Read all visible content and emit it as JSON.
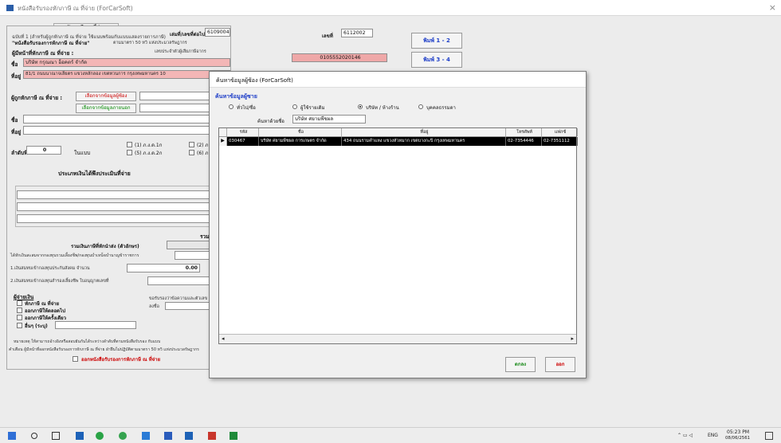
{
  "window": {
    "title": "หนังสือรับรองหักภาษี ณ ที่จ่าย (ForCarSoft)",
    "close": "×"
  },
  "form": {
    "tab_label": "หักภาษี ณ ที่จ่าย",
    "section_text1": "ฉบับที่ 1 (สำหรับผู้ถูกหักภาษี ณ ที่จ่าย ใช้แนบพร้อมกับแบบแสดงรายการภาษี)",
    "section_text2": "\"หนังสือรับรองการหักภาษี ณ ที่จ่าย\"",
    "law_text": "ตามมาตรา 50 ทวิ แห่งประมวลรัษฎากร",
    "book_no_label": "เล่มที่/เลขที่ต่อไป",
    "book_no_value": "6109004",
    "number_label": "เลขที่",
    "number_value": "6112002",
    "payer_label": "ผู้มีหน้าที่หักภาษี ณ ที่จ่าย :",
    "taxid_label": "เลขประจำตัวผู้เสียภาษีอากร",
    "taxid_value": "0105552020146",
    "name_label": "ชื่อ",
    "payer_name": "บริษัท กรุณณา อ็อคตร์ จำกัด",
    "address_label": "ที่อยู่",
    "payer_address": "81/1 ถนนนาณาจเลียตร แขวงหลักลอง เขตทวนการ กรุงเทพมหานคร 10",
    "payee_label": "ผู้ถูกหักภาษี ณ ที่จ่าย :",
    "btn_search_customer": "เลือกจากข้อมูลผู้ซ้อง",
    "btn_search_outside": "เลือกจากข้อมูลภายนอก",
    "order_label": "ลำดับที่",
    "order_value": "0",
    "in_form_label": "ในแบบ",
    "forms": [
      "(1) ภ.ง.ด.1ก",
      "(5) ภ.ง.ด.2ก",
      "(2) ภ.",
      "(6) ภ."
    ],
    "income_type_label": "ประเภทเงินได้พึงประเมินที่จ่าย",
    "total_label": "รวมเงินที่จ่าย",
    "total_tax_label": "รวมเงินภาษีที่หักนำส่ง (ตัวอักษร)",
    "fund_text": "ได้หักเงินสะสมจากกองทุนรวมเลี้ยงชีพ/กองทุนบำเหน็จบำนาญข้าราชการ",
    "social_text": "1.เงินสมทบเข้ากองทุนประกันสังคม จำนวน",
    "social_value": "0.00",
    "provident_text": "2.เงินสมทบเข้ากองทุนสำรองเลี้ยงชีพ ใบอนุญาตเลขที่",
    "payer_group_label": "ผู้จ่ายเงิน",
    "payer_options": [
      "หักภาษี ณ ที่จ่าย",
      "ออกภาษีให้ตลอดไป",
      "ออกภาษีให้ครั้งเดียว",
      "อื่นๆ (ระบุ)"
    ],
    "signature_label": "ขอรับรองว่าข้อความและตัวเลข",
    "sign_short": "ลงชื่อ",
    "note_text": "หมายเหตุ ให้สามารถอ้างอิงหรือสอบยันกันได้ระหว่างลำดับที่ตามหนังสือรับรอง กับแบบ",
    "warn_text": "คำเตือน ผู้มีหน้าที่ออกหนังสือรับรองการหักภาษี ณ ที่จ่าย ฝ่าฝืนไม่ปฏิบัติตามมาตรา 50 ทวิ แห่งประมวลรัษฎากร",
    "print_cert_label": "ออกหนังสือรับรองการหักภาษี ณ ที่จ่าย"
  },
  "side_buttons": {
    "print12": "พิมพ์ 1 - 2",
    "print34": "พิมพ์ 3 - 4"
  },
  "dialog": {
    "title": "ค้นหาข้อมูลผู้ซ้อง (ForCarSoft)",
    "legend": "ค้นหาข้อมูลผู้ซาย",
    "radios": [
      "ทั่วไป/ชื่อ",
      "ผู้ใช้รายเดิม",
      "บริษัท / ห้างร้าน",
      "บุคคลธรรมดา"
    ],
    "selected_radio": 2,
    "search_label": "ค้นหาด้วยชื่อ",
    "search_value": "บริษัท ศยามพืชผล",
    "columns": [
      "รหัส",
      "ชื่อ",
      "ที่อยู่",
      "โทรศัพท์",
      "แฟกซ์"
    ],
    "rows": [
      [
        "030467",
        "บริษัท ศยามพืชผล การเกษตร จำกัด",
        "434 ถนนรามคำแหง แขวงหัวหมาก เขตบางกะปิ กรุงเทพมหานคร",
        "02-7354446",
        "02-7351112"
      ]
    ],
    "ok_label": "ตกลง",
    "cancel_label": "ออก"
  },
  "taskbar": {
    "time": "05:23 PM",
    "date": "08/06/2561",
    "lang": "ENG"
  }
}
